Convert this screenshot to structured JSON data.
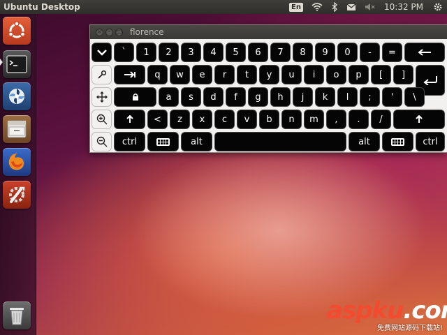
{
  "top_panel": {
    "title": "Ubuntu Desktop",
    "keyboard_layout": "En",
    "clock": "10:32 PM"
  },
  "launcher": {
    "items": [
      {
        "name": "dash-home",
        "icon": "ubuntu-logo-icon"
      },
      {
        "name": "terminal",
        "icon": "terminal-icon"
      },
      {
        "name": "shotwell",
        "icon": "shotwell-icon"
      },
      {
        "name": "files",
        "icon": "file-cabinet-icon"
      },
      {
        "name": "firefox",
        "icon": "firefox-icon"
      },
      {
        "name": "system-settings",
        "icon": "settings-icon"
      },
      {
        "name": "trash",
        "icon": "trash-icon"
      }
    ]
  },
  "florence": {
    "title": "florence",
    "rows": [
      [
        "`",
        "1",
        "2",
        "3",
        "4",
        "5",
        "6",
        "7",
        "8",
        "9",
        "0",
        "-",
        "="
      ],
      [
        "q",
        "w",
        "e",
        "r",
        "t",
        "y",
        "u",
        "i",
        "o",
        "p",
        "[",
        "]"
      ],
      [
        "a",
        "s",
        "d",
        "f",
        "g",
        "h",
        "j",
        "k",
        "l",
        ";",
        "'",
        "\\"
      ],
      [
        "<",
        "z",
        "x",
        "c",
        "v",
        "b",
        "n",
        "m",
        ",",
        ".",
        "/"
      ]
    ],
    "ctrl_label": "ctrl",
    "alt_label": "alt"
  },
  "watermark": {
    "main_a": "asp",
    "main_b": "ku",
    "main_c": ".com",
    "sub": "免费网站源码下载站!"
  },
  "colors": {
    "key_bg": "#050505",
    "key_text": "#ffffff",
    "panel_bg": "#2f2e2b",
    "watermark_red": "#f24b30"
  }
}
